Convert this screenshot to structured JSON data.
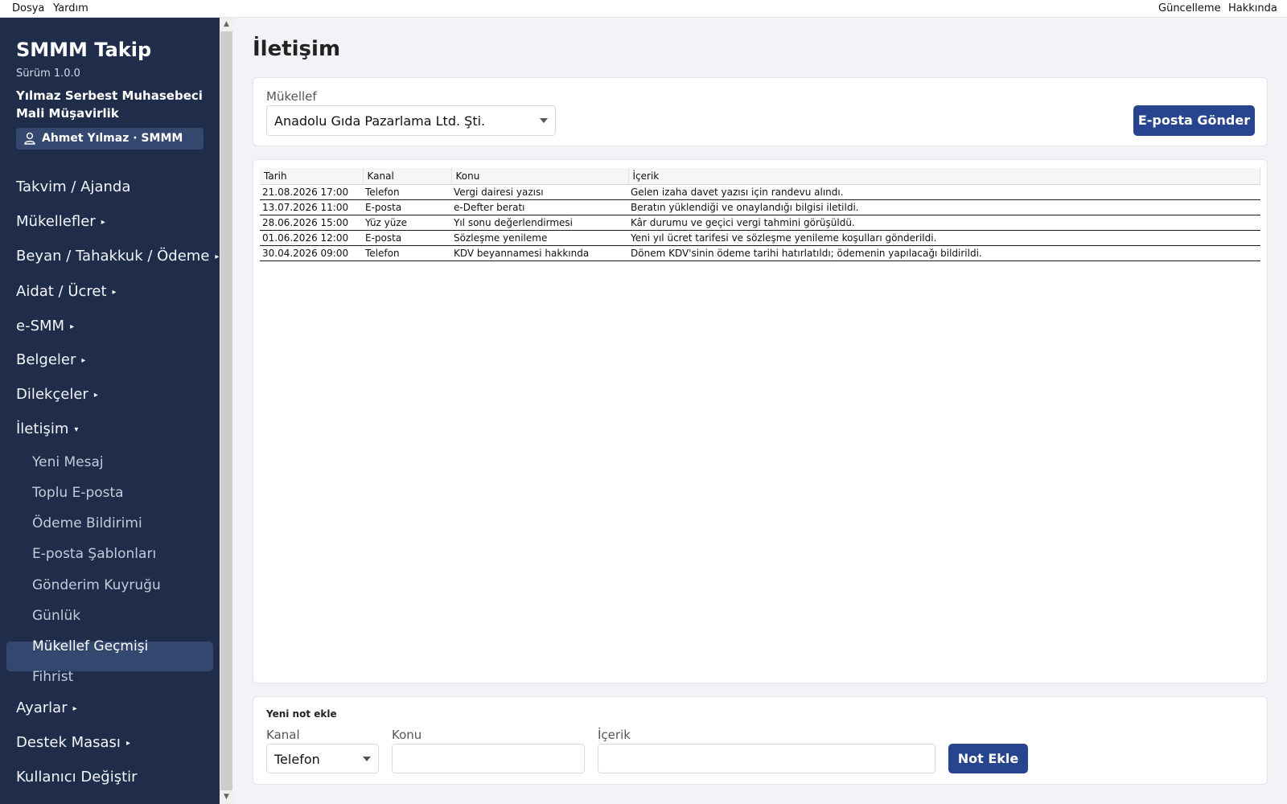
{
  "menubar": {
    "left": [
      "Dosya",
      "Yardım"
    ],
    "right": [
      "Güncelleme",
      "Hakkında"
    ]
  },
  "sidebar": {
    "app_title": "SMMM Takip",
    "version": "Sürüm 1.0.0",
    "office_line1": "Yılmaz Serbest Muhasebeci",
    "office_line2": "Mali Müşavirlik",
    "user": "Ahmet Yılmaz · SMMM",
    "nav": [
      {
        "label": "Takvim / Ajanda",
        "arrow": ""
      },
      {
        "label": "Mükellefler",
        "arrow": "▸"
      },
      {
        "label": "Beyan / Tahakkuk / Ödeme",
        "arrow": "▸"
      },
      {
        "label": "Aidat / Ücret",
        "arrow": "▸"
      },
      {
        "label": "e-SMM",
        "arrow": "▸"
      },
      {
        "label": "Belgeler",
        "arrow": "▸"
      },
      {
        "label": "Dilekçeler",
        "arrow": "▸"
      },
      {
        "label": "İletişim",
        "arrow": "▾"
      },
      {
        "label": "Ayarlar",
        "arrow": "▸"
      },
      {
        "label": "Destek Masası",
        "arrow": "▸"
      },
      {
        "label": "Kullanıcı Değiştir",
        "arrow": ""
      }
    ],
    "subnav": [
      "Yeni Mesaj",
      "Toplu E-posta",
      "Ödeme Bildirimi",
      "E-posta Şablonları",
      "Gönderim Kuyruğu",
      "Günlük",
      "Mükellef Geçmişi",
      "Fihrist"
    ],
    "active_sub": "Mükellef Geçmişi"
  },
  "page": {
    "title": "İletişim",
    "mukellef_label": "Mükellef",
    "mukellef_value": "Anadolu Gıda Pazarlama Ltd. Şti.",
    "send_email": "E-posta Gönder"
  },
  "table": {
    "columns": [
      "Tarih",
      "Kanal",
      "Konu",
      "İçerik"
    ],
    "rows": [
      [
        "21.08.2026 17:00",
        "Telefon",
        "Vergi dairesi yazısı",
        "Gelen izaha davet yazısı için randevu alındı."
      ],
      [
        "13.07.2026 11:00",
        "E-posta",
        "e-Defter beratı",
        "Beratın yüklendiği ve onaylandığı bilgisi iletildi."
      ],
      [
        "28.06.2026 15:00",
        "Yüz yüze",
        "Yıl sonu değerlendirmesi",
        "Kâr durumu ve geçici vergi tahmini görüşüldü."
      ],
      [
        "01.06.2026 12:00",
        "E-posta",
        "Sözleşme yenileme",
        "Yeni yıl ücret tarifesi ve sözleşme yenileme koşulları gönderildi."
      ],
      [
        "30.04.2026 09:00",
        "Telefon",
        "KDV beyannamesi hakkında",
        "Dönem KDV'sinin ödeme tarihi hatırlatıldı; ödemenin yapılacağı bildirildi."
      ]
    ]
  },
  "note_form": {
    "heading": "Yeni not ekle",
    "kanal_label": "Kanal",
    "kanal_value": "Telefon",
    "konu_label": "Konu",
    "konu_value": "",
    "icerik_label": "İçerik",
    "icerik_value": "",
    "submit": "Not Ekle"
  },
  "colors": {
    "sidebar": "#1f2d4b",
    "accent": "#27458e",
    "active": "#34476e"
  }
}
